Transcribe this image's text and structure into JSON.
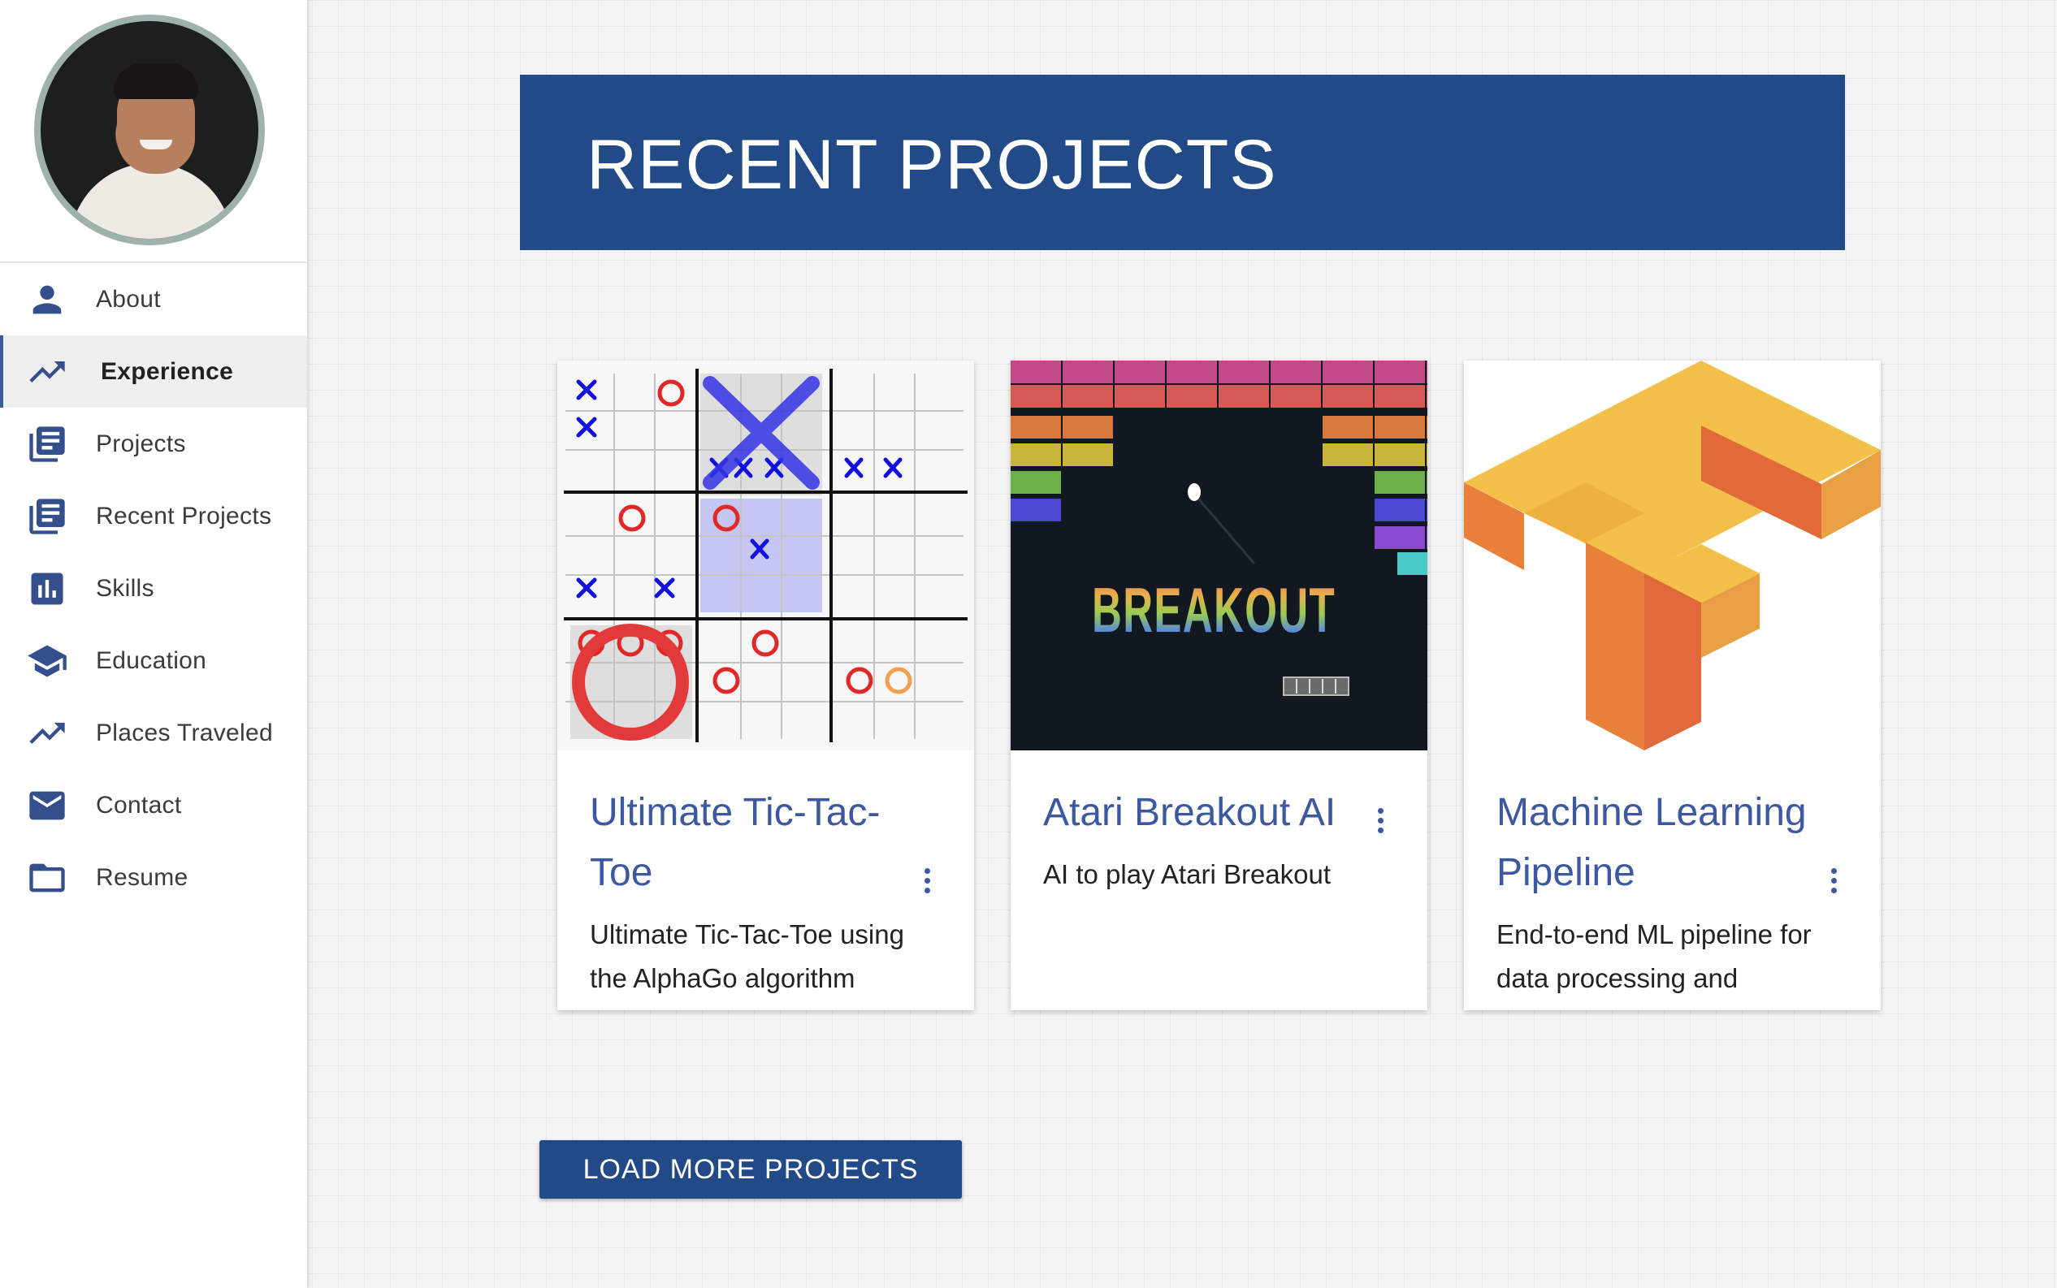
{
  "sidebar": {
    "items": [
      {
        "label": "About",
        "icon": "person-icon"
      },
      {
        "label": "Experience",
        "icon": "trending-up-icon",
        "active": true
      },
      {
        "label": "Projects",
        "icon": "library-books-icon"
      },
      {
        "label": "Recent Projects",
        "icon": "library-books-icon"
      },
      {
        "label": "Skills",
        "icon": "bar-chart-icon"
      },
      {
        "label": "Education",
        "icon": "school-icon"
      },
      {
        "label": "Places Traveled",
        "icon": "trending-up-icon"
      },
      {
        "label": "Contact",
        "icon": "mail-icon"
      },
      {
        "label": "Resume",
        "icon": "folder-icon"
      }
    ]
  },
  "header": {
    "title": "RECENT PROJECTS"
  },
  "projects": [
    {
      "title": "Ultimate Tic-Tac-Toe",
      "description": "Ultimate Tic-Tac-Toe using the AlphaGo algorithm",
      "image": "ultimate-tic-tac-toe-board"
    },
    {
      "title": "Atari Breakout AI",
      "description": "AI to play Atari Breakout",
      "image": "breakout-game-screen",
      "logo_text": "BREAKOUT"
    },
    {
      "title": "Machine Learning Pipeline",
      "description": "End-to-end ML pipeline for data processing and",
      "image": "tensorflow-logo"
    }
  ],
  "actions": {
    "load_more": "LOAD MORE PROJECTS"
  },
  "colors": {
    "accent": "#224a87",
    "link": "#3b58a0",
    "icon": "#354e8c"
  }
}
